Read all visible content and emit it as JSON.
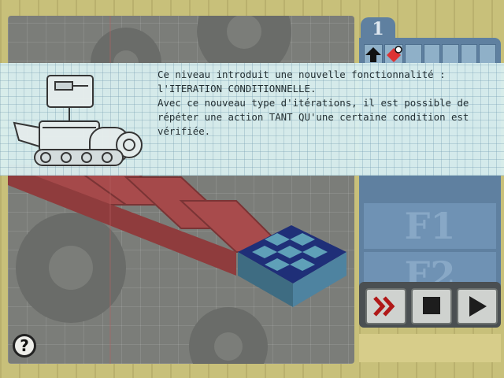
{
  "level": {
    "number": "1"
  },
  "message": {
    "text": "Ce niveau introduit une nouvelle fonctionnalité :\nl'ITERATION CONDITIONNELLE.\nAvec ce nouveau type d'itérations, il est possible de\nrépéter une action TANT QU'une certaine condition est\nvérifiée."
  },
  "functions": {
    "f1": "F1",
    "f2": "F2"
  },
  "controls": {
    "help": "?"
  },
  "icons": {
    "slot_1": "up-arrow-icon",
    "slot_2": "red-diamond-icon",
    "slot_2_badge": "condition-marker-icon",
    "fast_forward": "fast-forward-icon",
    "stop": "stop-icon",
    "play": "play-icon",
    "help": "help-icon"
  },
  "colors": {
    "path": "#a5494a",
    "goal_tile": "#1f2f78",
    "panel": "#5f80a0",
    "overlay": "#d9efef"
  }
}
